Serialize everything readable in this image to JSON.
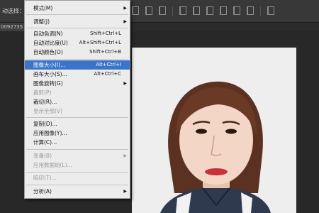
{
  "options_bar": {
    "label": "动选择："
  },
  "doc_tab": {
    "label": "0092735"
  },
  "menu": {
    "items": [
      {
        "label": "模式(M)",
        "shortcut": "",
        "submenu": true,
        "disabled": false,
        "highlighted": false
      },
      {
        "label": "调整(J)",
        "shortcut": "",
        "submenu": true,
        "disabled": false,
        "highlighted": false
      },
      {
        "label": "自动色调(N)",
        "shortcut": "Shift+Ctrl+L",
        "submenu": false,
        "disabled": false,
        "highlighted": false
      },
      {
        "label": "自动对比度(U)",
        "shortcut": "Alt+Shift+Ctrl+L",
        "submenu": false,
        "disabled": false,
        "highlighted": false
      },
      {
        "label": "自动颜色(O)",
        "shortcut": "Shift+Ctrl+B",
        "submenu": false,
        "disabled": false,
        "highlighted": false
      },
      {
        "label": "图像大小(I)...",
        "shortcut": "Alt+Ctrl+I",
        "submenu": false,
        "disabled": false,
        "highlighted": true
      },
      {
        "label": "画布大小(S)...",
        "shortcut": "Alt+Ctrl+C",
        "submenu": false,
        "disabled": false,
        "highlighted": false
      },
      {
        "label": "图像旋转(G)",
        "shortcut": "",
        "submenu": true,
        "disabled": false,
        "highlighted": false
      },
      {
        "label": "裁剪(P)",
        "shortcut": "",
        "submenu": false,
        "disabled": true,
        "highlighted": false
      },
      {
        "label": "裁切(R)...",
        "shortcut": "",
        "submenu": false,
        "disabled": false,
        "highlighted": false
      },
      {
        "label": "显示全部(V)",
        "shortcut": "",
        "submenu": false,
        "disabled": true,
        "highlighted": false
      },
      {
        "label": "复制(D)...",
        "shortcut": "",
        "submenu": false,
        "disabled": false,
        "highlighted": false
      },
      {
        "label": "应用图像(Y)...",
        "shortcut": "",
        "submenu": false,
        "disabled": false,
        "highlighted": false
      },
      {
        "label": "计算(C)...",
        "shortcut": "",
        "submenu": false,
        "disabled": false,
        "highlighted": false
      },
      {
        "label": "变量(B)",
        "shortcut": "",
        "submenu": true,
        "disabled": true,
        "highlighted": false
      },
      {
        "label": "应用数据组(L)...",
        "shortcut": "",
        "submenu": false,
        "disabled": true,
        "highlighted": false
      },
      {
        "label": "陷印(T)...",
        "shortcut": "",
        "submenu": false,
        "disabled": true,
        "highlighted": false
      },
      {
        "label": "分析(A)",
        "shortcut": "",
        "submenu": true,
        "disabled": false,
        "highlighted": false
      }
    ]
  },
  "colors": {
    "menu_highlight": "#3b74c9",
    "menu_background": "#ececec",
    "workspace": "#282828"
  },
  "photo": {
    "icon": "portrait-photo"
  }
}
